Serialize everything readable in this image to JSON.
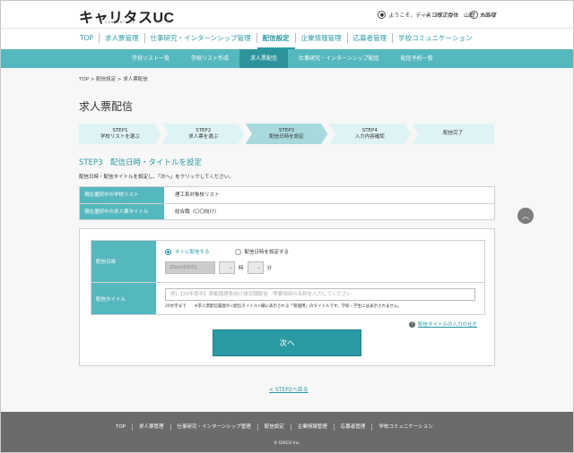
{
  "header": {
    "logo": "キャリタスUC",
    "logo_sub": "CAREERTASU",
    "user_greeting": "ようこそ、ディスコ株式会社　山田　太郎様",
    "logout": "ログアウト",
    "help": "ヘルプ"
  },
  "mainnav": {
    "items": [
      "TOP",
      "求人票管理",
      "仕事研究・インターンシップ管理",
      "配信設定",
      "企業情報管理",
      "応募者管理",
      "学校コミュニケーション"
    ],
    "active_index": 3
  },
  "subnav": {
    "items": [
      "学校リスト一覧",
      "学校リスト作成",
      "求人票配信",
      "仕事研究・インターンシップ配信",
      "配信予約一覧"
    ],
    "active_index": 2
  },
  "breadcrumb": "TOP > 配信設定 > 求人票配信",
  "page_title": "求人票配信",
  "steps": [
    {
      "num": "STEP1",
      "label": "学校リストを選ぶ"
    },
    {
      "num": "STEP2",
      "label": "求人票を選ぶ"
    },
    {
      "num": "STEP3",
      "label": "配信日時を設定"
    },
    {
      "num": "STEP4",
      "label": "入力内容確認"
    },
    {
      "num": "",
      "label": "配信完了"
    }
  ],
  "step_heading": "STEP3　配信日時・タイトルを設定",
  "step_desc": "配信日時・配信タイトルを設定し、「次へ」をクリックしてください。",
  "info": {
    "school_list_label": "現在選択中の学校リスト",
    "school_list_value": "理工系対象校リスト",
    "job_title_label": "現在選択中の求人票タイトル",
    "job_title_value": "総合職（〇〇向け）"
  },
  "form": {
    "date_label": "配信日時",
    "radio_now": "すぐに配信する",
    "radio_schedule": "配信日時を設定する",
    "date_placeholder": "20xx/03/01",
    "hour_unit": "時",
    "minute_unit": "分",
    "title_label": "配信タイトル",
    "title_placeholder": "例）【20年度卒】首都圏理系向け研究職配信　等要項用の名称を入力してください",
    "note": "20文字まで　　※求人票配信履歴の<配信タイトル>欄に表示される「管理用」のタイトルです。学校・学生には表示されません。"
  },
  "help_link": "配信タイトルの入力の仕方",
  "next_button": "次へ",
  "back_link": "< STEP2へ戻る",
  "footer": {
    "items": [
      "TOP",
      "求人票管理",
      "仕事研究・インターンシップ管理",
      "配信設定",
      "企業情報管理",
      "応募者管理",
      "学校コミュニケーション"
    ],
    "copyright": "© DISCO Inc."
  },
  "colors": {
    "accent": "#2a9aa3",
    "subnav": "#55b8be",
    "footer": "#6b6b6b"
  }
}
